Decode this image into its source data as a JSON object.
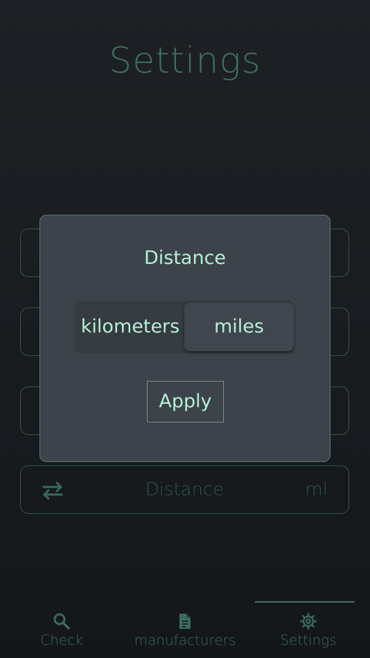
{
  "page": {
    "title": "Settings"
  },
  "rows": [
    {
      "label": "",
      "value": "",
      "icon": "blank"
    },
    {
      "label": "",
      "value": "",
      "icon": "blank"
    },
    {
      "label": "",
      "value": "",
      "icon": "blank"
    },
    {
      "label": "Distance",
      "value": "ml",
      "icon": "swap-arrows-icon"
    }
  ],
  "modal": {
    "title": "Distance",
    "options": [
      "kilometers",
      "miles"
    ],
    "selected_option": "miles",
    "apply_label": "Apply"
  },
  "nav": {
    "items": [
      {
        "label": "Check",
        "icon": "search-icon"
      },
      {
        "label": "manufacturers",
        "icon": "document-icon"
      },
      {
        "label": "Settings",
        "icon": "gear-icon"
      }
    ],
    "active": "Settings"
  },
  "colors": {
    "accent": "#b5f0d5",
    "dim_accent": "#3f6e5f",
    "modal_bg": "#3c434a",
    "page_bg": "#1b1f22"
  }
}
